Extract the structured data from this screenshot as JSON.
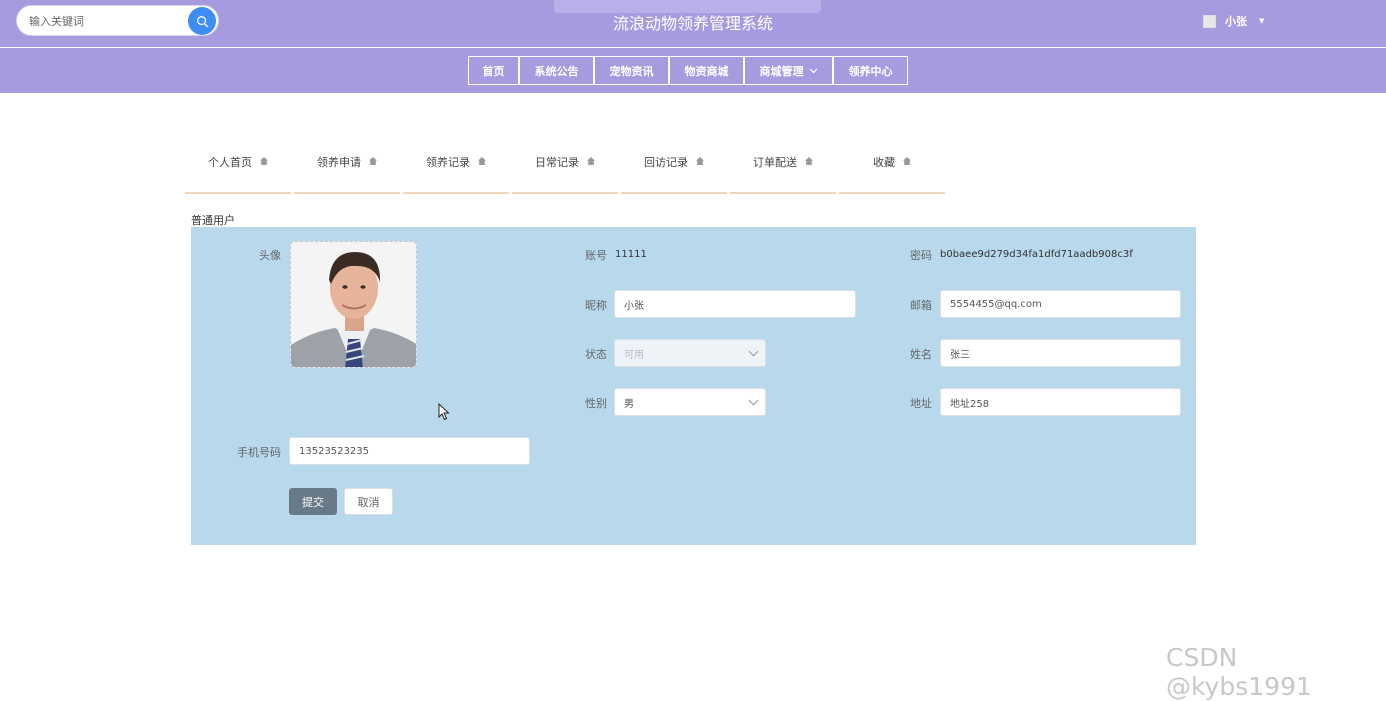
{
  "header": {
    "site_title": "流浪动物领养管理系统",
    "search_placeholder": "输入关键词",
    "user_name": "小张",
    "user_caret": "▼"
  },
  "nav": {
    "items": [
      {
        "label": "首页"
      },
      {
        "label": "系统公告"
      },
      {
        "label": "宠物资讯"
      },
      {
        "label": "物资商城"
      },
      {
        "label": "商城管理"
      },
      {
        "label": "领养中心"
      }
    ]
  },
  "tabs": [
    {
      "label": "个人首页"
    },
    {
      "label": "领养申请"
    },
    {
      "label": "领养记录"
    },
    {
      "label": "日常记录"
    },
    {
      "label": "回访记录"
    },
    {
      "label": "订单配送"
    },
    {
      "label": "收藏"
    }
  ],
  "profile": {
    "role": "普通用户",
    "avatar_label": "头像",
    "account_label": "账号",
    "account_value": "11111",
    "password_label": "密码",
    "password_value": "b0baee9d279d34fa1dfd71aadb908c3f",
    "nickname_label": "昵称",
    "nickname_value": "小张",
    "email_label": "邮箱",
    "email_value": "5554455@qq.com",
    "status_label": "状态",
    "status_value": "可用",
    "name_label": "姓名",
    "name_value": "张三",
    "gender_label": "性别",
    "gender_value": "男",
    "address_label": "地址",
    "address_value": "地址258",
    "phone_label": "手机号码",
    "phone_value": "13523523235",
    "submit_label": "提交",
    "cancel_label": "取消"
  },
  "watermark": "CSDN @kybs1991",
  "colors": {
    "header_bg": "#a79be0",
    "panel_bg": "#b8d8ec",
    "search_button": "#3d8df5",
    "submit_button": "#687a87",
    "tab_underline": "#f2d5b8"
  }
}
